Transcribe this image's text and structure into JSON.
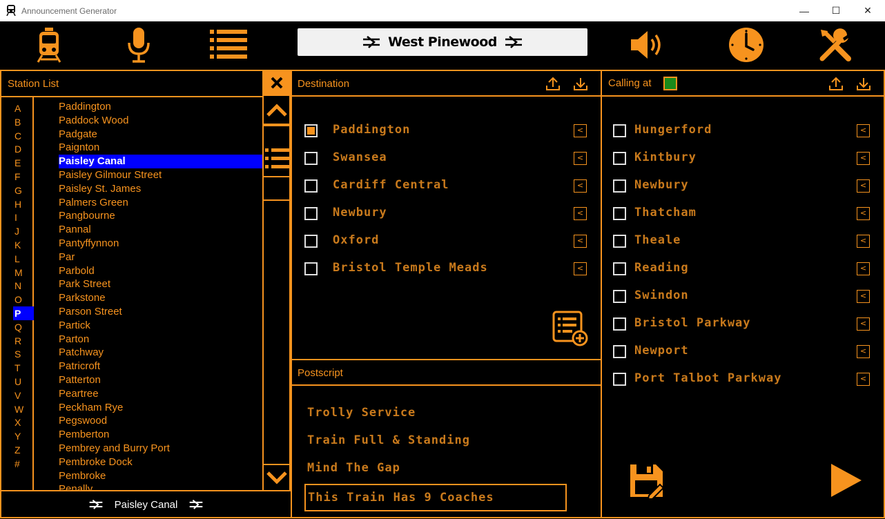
{
  "window": {
    "title": "Announcement Generator",
    "minimize": "—",
    "maximize": "☐",
    "close": "✕"
  },
  "toolbar": {
    "current_station": "West Pinewood"
  },
  "station_list": {
    "header": "Station List",
    "letters": [
      "A",
      "B",
      "C",
      "D",
      "E",
      "F",
      "G",
      "H",
      "I",
      "J",
      "K",
      "L",
      "M",
      "N",
      "O",
      "P",
      "Q",
      "R",
      "S",
      "T",
      "U",
      "V",
      "W",
      "X",
      "Y",
      "Z",
      "#"
    ],
    "selected_letter": "P",
    "stations": [
      "Paddington",
      "Paddock Wood",
      "Padgate",
      "Paignton",
      "Paisley Canal",
      "Paisley Gilmour Street",
      "Paisley St. James",
      "Palmers Green",
      "Pangbourne",
      "Pannal",
      "Pantyffynnon",
      "Par",
      "Parbold",
      "Park Street",
      "Parkstone",
      "Parson Street",
      "Partick",
      "Parton",
      "Patchway",
      "Patricroft",
      "Patterton",
      "Peartree",
      "Peckham Rye",
      "Pegswood",
      "Pemberton",
      "Pembrey and Burry Port",
      "Pembroke Dock",
      "Pembroke",
      "Penally"
    ],
    "selected_station": "Paisley Canal",
    "footer_station": "Paisley Canal"
  },
  "destination": {
    "header": "Destination",
    "items": [
      {
        "label": "Paddington",
        "checked": true
      },
      {
        "label": "Swansea",
        "checked": false
      },
      {
        "label": "Cardiff Central",
        "checked": false
      },
      {
        "label": "Newbury",
        "checked": false
      },
      {
        "label": "Oxford",
        "checked": false
      },
      {
        "label": "Bristol Temple Meads",
        "checked": false
      }
    ],
    "remove_glyph": "<"
  },
  "postscript": {
    "header": "Postscript",
    "items": [
      "Trolly Service",
      "Train Full & Standing",
      "Mind The Gap"
    ],
    "coaches_text": "This Train Has  9  Coaches"
  },
  "calling_at": {
    "header": "Calling at",
    "items": [
      {
        "label": "Hungerford",
        "checked": false
      },
      {
        "label": "Kintbury",
        "checked": false
      },
      {
        "label": "Newbury",
        "checked": false
      },
      {
        "label": "Thatcham",
        "checked": false
      },
      {
        "label": "Theale",
        "checked": false
      },
      {
        "label": "Reading",
        "checked": false
      },
      {
        "label": "Swindon",
        "checked": false
      },
      {
        "label": "Bristol Parkway",
        "checked": false
      },
      {
        "label": "Newport",
        "checked": false
      },
      {
        "label": "Port Talbot Parkway",
        "checked": false
      }
    ],
    "remove_glyph": "<"
  },
  "colors": {
    "accent": "#f7931e",
    "selection": "#0000ff",
    "indicator": "#1a8a1a",
    "background": "#000000"
  }
}
